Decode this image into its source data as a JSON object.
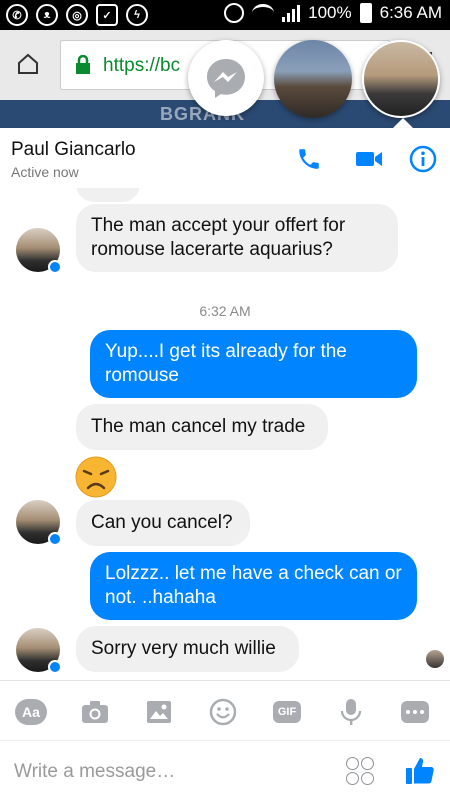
{
  "status_bar": {
    "battery": "100%",
    "time": "6:36 AM",
    "left_icons": [
      "whatsapp-icon",
      "cat-app-icon",
      "chrome-icon",
      "briefcase-icon",
      "messenger-icon"
    ]
  },
  "browser": {
    "url": "https://bc"
  },
  "background_site": {
    "logo_text": "BGRANK"
  },
  "chat_header": {
    "name": "Paul Giancarlo",
    "status": "Active now"
  },
  "messages": {
    "m1": "The man accept your offert for romouse lacerarte aquarius?",
    "time1": "6:32 AM",
    "m2": "Yup....I get its already for the romouse",
    "m3": "The man cancel my trade",
    "m4": "Can you cancel?",
    "m5": "Lolzzz.. let me have a check can or not.  ..hahaha",
    "m6": "Sorry very much willie"
  },
  "toolbar": {
    "text_button": "Aa",
    "gif_button": "GIF"
  },
  "composer": {
    "placeholder": "Write a message…"
  },
  "colors": {
    "accent": "#0084ff",
    "incoming_bubble": "#f0f0f0",
    "icon_gray": "#a9acb1"
  }
}
